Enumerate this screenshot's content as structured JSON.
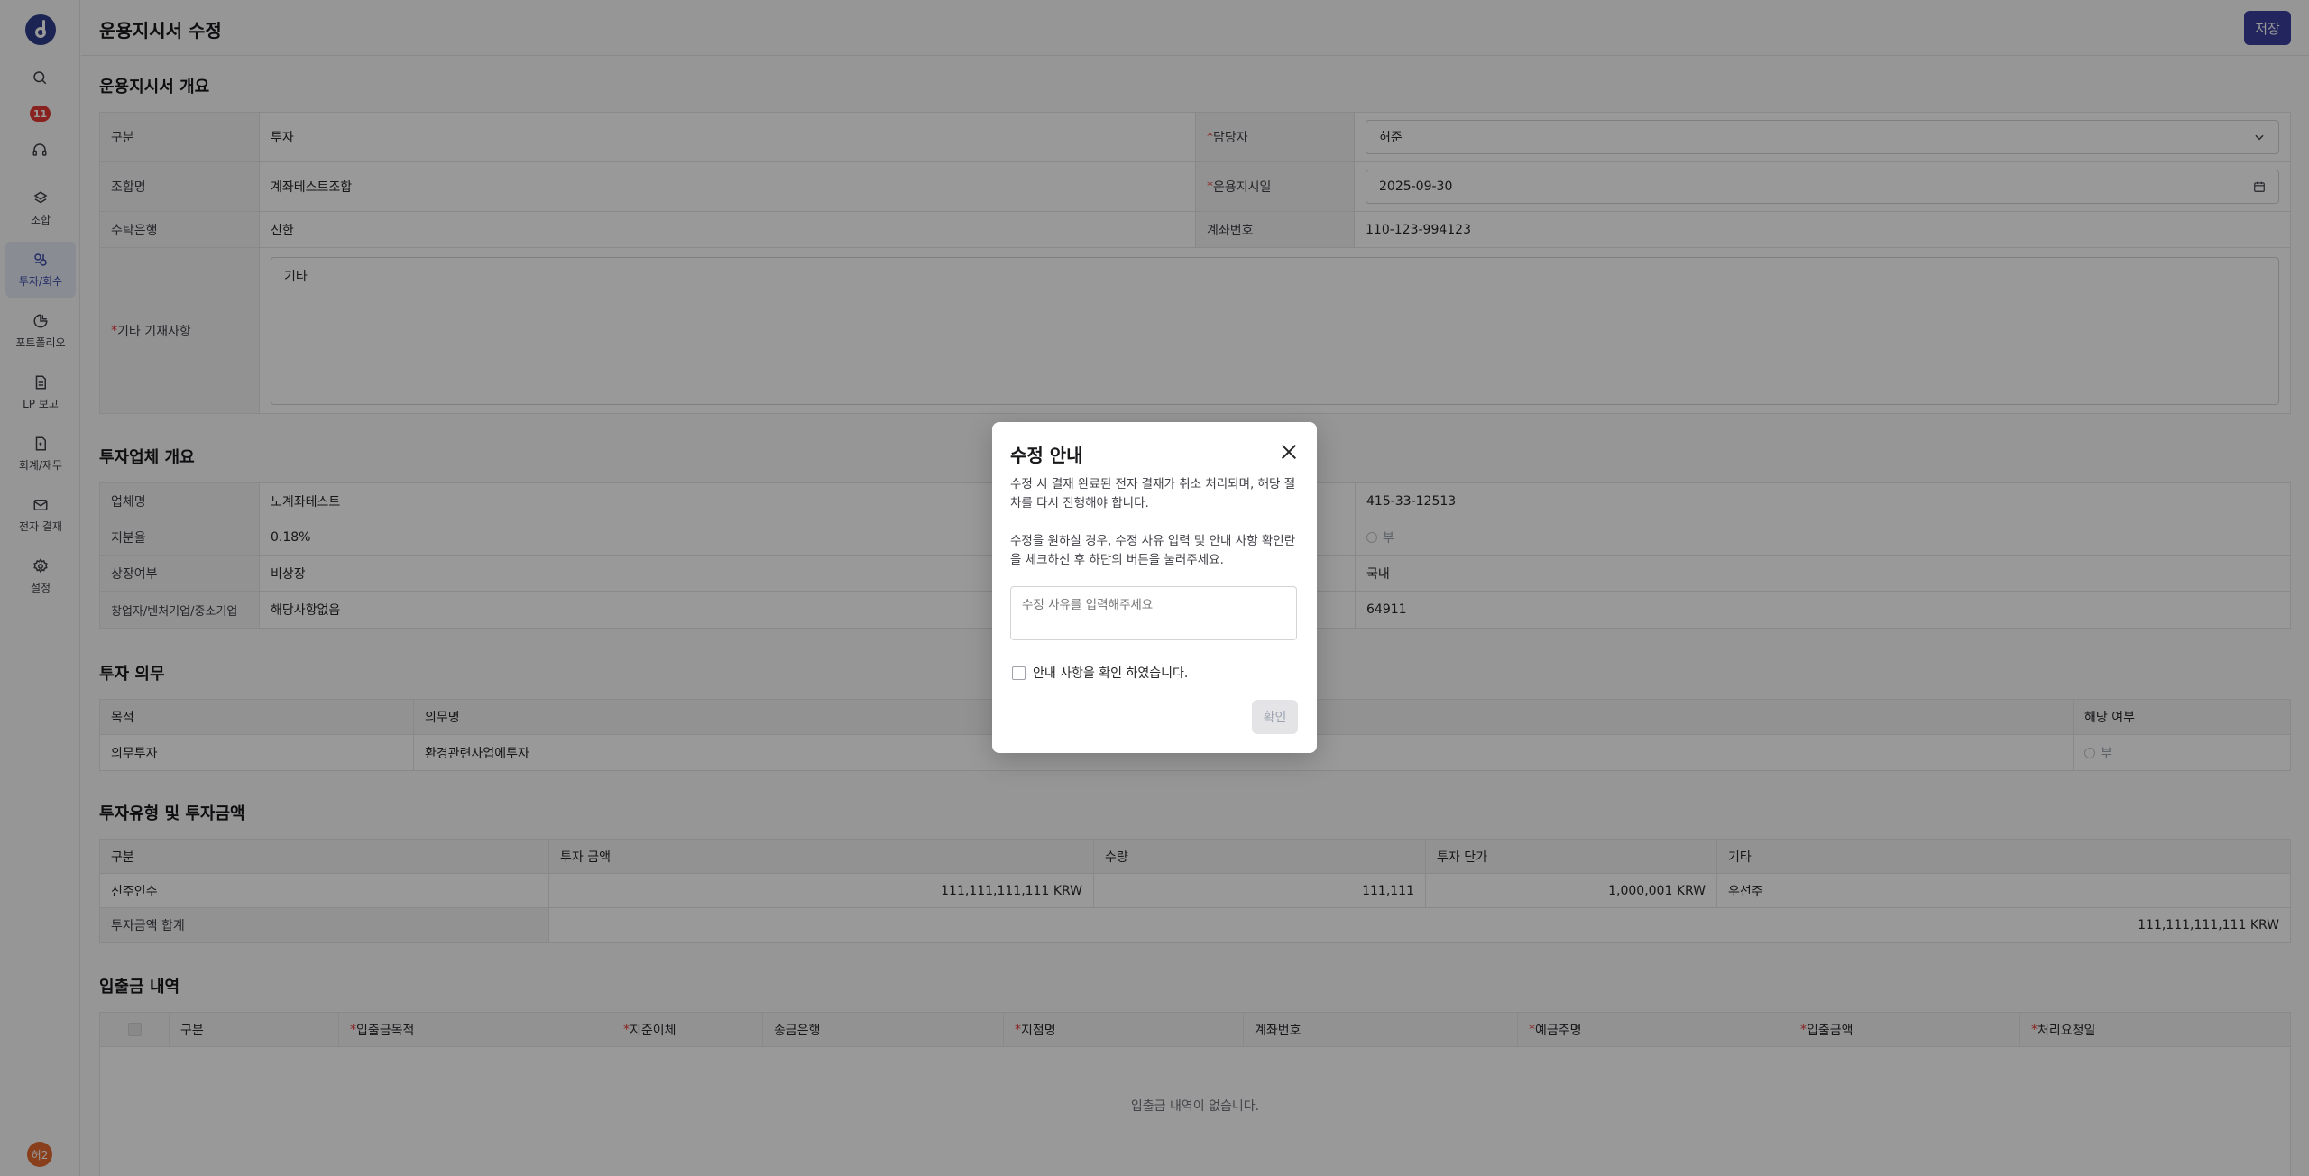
{
  "header": {
    "title": "운용지시서 수정",
    "save_label": "저장"
  },
  "sidebar": {
    "badge_count": "11",
    "items": [
      {
        "label": "조합",
        "icon": "fund-icon"
      },
      {
        "label": "투자/회수",
        "icon": "invest-icon"
      },
      {
        "label": "포트폴리오",
        "icon": "portfolio-icon"
      },
      {
        "label": "LP 보고",
        "icon": "report-icon"
      },
      {
        "label": "회계/재무",
        "icon": "accounting-icon"
      },
      {
        "label": "전자 결재",
        "icon": "mail-icon"
      },
      {
        "label": "설정",
        "icon": "gear-icon"
      }
    ],
    "avatar": "허2"
  },
  "overview": {
    "title": "운용지시서 개요",
    "category_label": "구분",
    "category_value": "투자",
    "manager_label": "담당자",
    "manager_value": "허준",
    "fund_label": "조합명",
    "fund_value": "계좌테스트조합",
    "date_label": "운용지시일",
    "date_value": "2025-09-30",
    "bank_label": "수탁은행",
    "bank_value": "신한",
    "account_label": "계좌번호",
    "account_value": "110-123-994123",
    "etc_label": "기타 기재사항",
    "etc_value": "기타"
  },
  "company": {
    "title": "투자업체 개요",
    "name_label": "업체명",
    "name_value": "노계좌테스트",
    "name_right": "415-33-12513",
    "share_label": "지분율",
    "share_value": "0.18%",
    "share_right": "부",
    "listed_label": "상장여부",
    "listed_value": "비상장",
    "listed_right": "국내",
    "venture_label": "창업자/벤처기업/중소기업",
    "venture_value": "해당사항없음",
    "venture_right": "64911"
  },
  "duty": {
    "title": "투자 의무",
    "headers": [
      "목적",
      "의무명",
      "해당 여부"
    ],
    "row": [
      "의무투자",
      "환경관련사업에투자",
      "부"
    ]
  },
  "amount": {
    "title": "투자유형 및 투자금액",
    "headers": [
      "구분",
      "투자 금액",
      "수량",
      "투자 단가",
      "기타"
    ],
    "row": [
      "신주인수",
      "111,111,111,111 KRW",
      "111,111",
      "1,000,001 KRW",
      "우선주"
    ],
    "total_label": "투자금액 합계",
    "total_value": "111,111,111,111 KRW"
  },
  "cashflow": {
    "title": "입출금 내역",
    "headers": [
      "구분",
      "입출금목적",
      "지준이체",
      "송금은행",
      "지점명",
      "계좌번호",
      "예금주명",
      "입출금액",
      "처리요청일"
    ],
    "empty": "입출금 내역이 없습니다."
  },
  "modal": {
    "title": "수정 안내",
    "text1": "수정 시 결재 완료된 전자 결재가 취소 처리되며, 해당 절차를 다시 진행해야 합니다.",
    "text2": "수정을 원하실 경우, 수정 사유 입력 및 안내 사항 확인란을 체크하신 후 하단의 버튼을 눌러주세요.",
    "reason_placeholder": "수정 사유를 입력해주세요",
    "check_label": "안내 사항을 확인 하였습니다.",
    "confirm_label": "확인"
  }
}
